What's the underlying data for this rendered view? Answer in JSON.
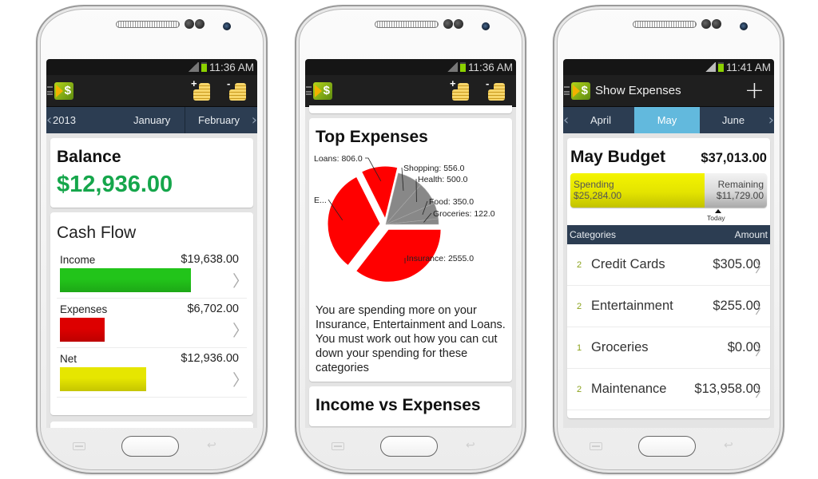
{
  "phones": [
    {
      "status": {
        "time": "11:36 AM"
      },
      "actionbar": {
        "icons": [
          "menu-icon",
          "app-logo-icon",
          "add-income-coins-icon",
          "add-expense-coins-icon"
        ],
        "income_sign": "+",
        "expense_sign": "-"
      },
      "monthbar": {
        "prev_chevron": "‹",
        "next_chevron": "›",
        "items": [
          "2013",
          "January",
          "February"
        ]
      },
      "balance": {
        "title": "Balance",
        "value": "$12,936.00",
        "value_color": "#15a64b"
      },
      "cash_flow": {
        "title": "Cash Flow",
        "rows": [
          {
            "label": "Income",
            "value": "$19,638.00",
            "amount": 19638,
            "color": "#22c41a"
          },
          {
            "label": "Expenses",
            "value": "$6,702.00",
            "amount": 6702,
            "color": "#dd0000"
          },
          {
            "label": "Net",
            "value": "$12,936.00",
            "amount": 12936,
            "color": "#e6e600"
          }
        ],
        "row_chevron": "〉"
      }
    },
    {
      "status": {
        "time": "11:36 AM"
      },
      "actionbar": {
        "icons": [
          "menu-icon",
          "app-logo-icon",
          "add-income-coins-icon",
          "add-expense-coins-icon"
        ],
        "income_sign": "+",
        "expense_sign": "-"
      },
      "top_expenses": {
        "title": "Top Expenses",
        "advice": "You are spending more on your Insurance, Entertainment and Loans. You must work out how you can cut down your spending for these categories"
      },
      "income_vs_expenses": {
        "title": "Income vs Expenses"
      }
    },
    {
      "status": {
        "time": "11:41 AM"
      },
      "actionbar": {
        "title": "Show Expenses",
        "add_icon": "+"
      },
      "monthbar": {
        "prev_chevron": "‹",
        "next_chevron": "›",
        "items": [
          "April",
          "May",
          "June"
        ],
        "active": "May",
        "active_color": "#62b9dd"
      },
      "budget": {
        "title": "May Budget",
        "total": "$37,013.00",
        "spending_label": "Spending",
        "spending_value": "$25,284.00",
        "remaining_label": "Remaining",
        "remaining_value": "$11,729.00",
        "spent_fraction": 0.683,
        "today_label": "Today"
      },
      "categories": {
        "header_left": "Categories",
        "header_right": "Amount",
        "rows": [
          {
            "count": "2",
            "name": "Credit Cards",
            "amount": "$305.00"
          },
          {
            "count": "2",
            "name": "Entertainment",
            "amount": "$255.00"
          },
          {
            "count": "1",
            "name": "Groceries",
            "amount": "$0.00"
          },
          {
            "count": "2",
            "name": "Maintenance",
            "amount": "$13,958.00"
          }
        ],
        "row_chevron": "〉"
      }
    }
  ],
  "chart_data": {
    "type": "pie",
    "title": "Top Expenses",
    "slices": [
      {
        "label": "Insurance",
        "display": "Insurance: 2555.0",
        "value": 2555.0,
        "color": "#ff0000",
        "exploded": true
      },
      {
        "label": "Entertainment",
        "display": "E...",
        "value": 2313.0,
        "color": "#ff0000",
        "exploded": true
      },
      {
        "label": "Loans",
        "display": "Loans: 806.0",
        "value": 806.0,
        "color": "#ff0000",
        "exploded": true
      },
      {
        "label": "Shopping",
        "display": "Shopping: 556.0",
        "value": 556.0,
        "color": "#888888",
        "exploded": false
      },
      {
        "label": "Health",
        "display": "Health: 500.0",
        "value": 500.0,
        "color": "#888888",
        "exploded": false
      },
      {
        "label": "Food",
        "display": "Food: 350.0",
        "value": 350.0,
        "color": "#888888",
        "exploded": false
      },
      {
        "label": "Groceries",
        "display": "Groceries: 122.0",
        "value": 122.0,
        "color": "#888888",
        "exploded": false
      }
    ],
    "legend": "inline-labels"
  }
}
